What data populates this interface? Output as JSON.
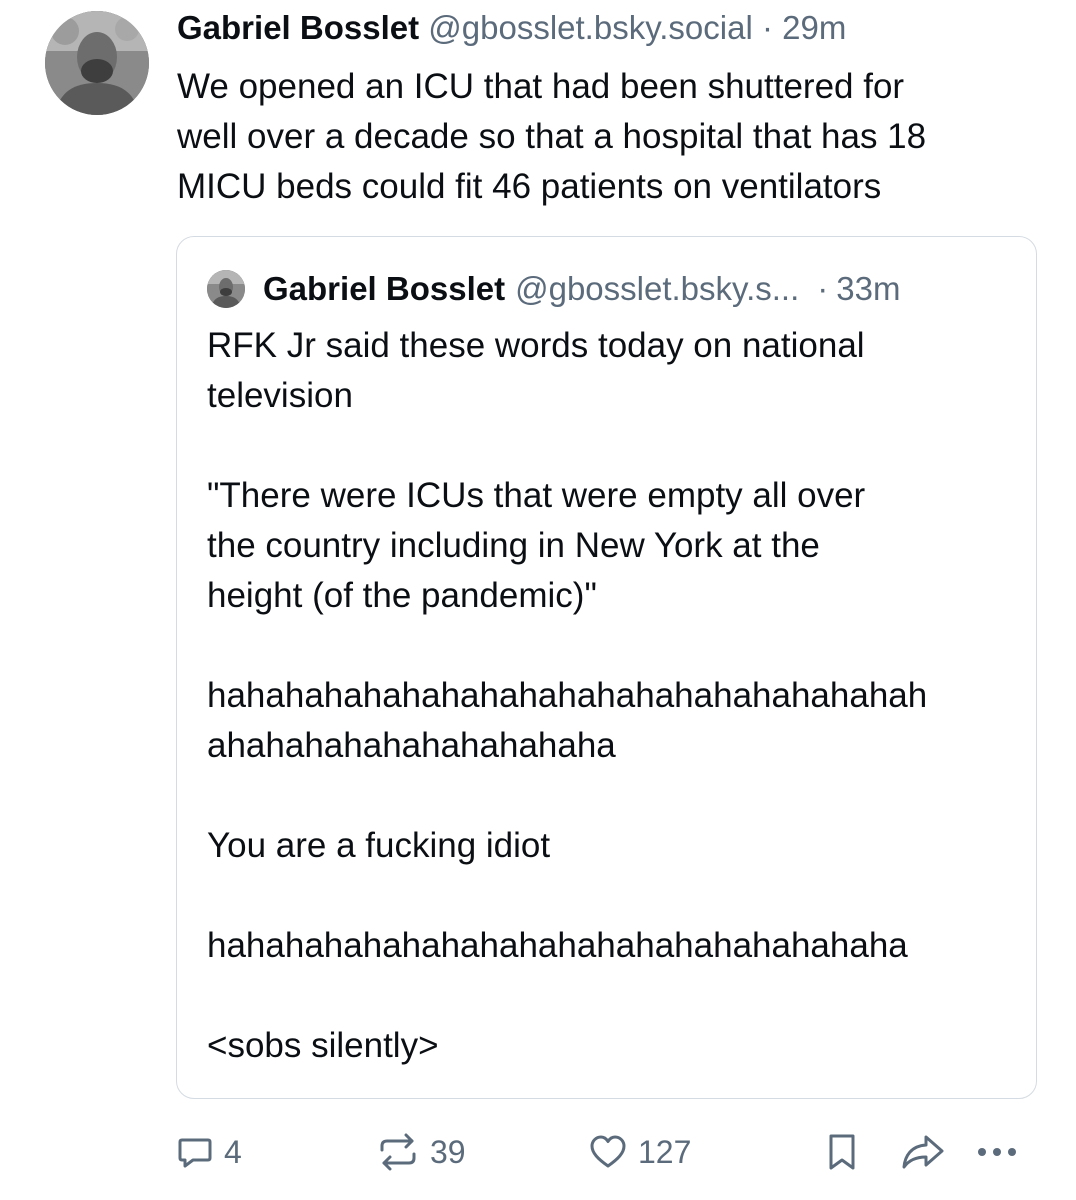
{
  "post": {
    "author_name": "Gabriel Bosslet",
    "handle": "@gbosslet.bsky.social",
    "separator": "·",
    "time": "29m",
    "text_lines": [
      "We opened an ICU that had been shuttered for",
      "well over a decade so that a hospital that has 18",
      "MICU beds could fit 46 patients on ventilators"
    ]
  },
  "quote": {
    "author_name": "Gabriel Bosslet",
    "handle": "@gbosslet.bsky.s...",
    "separator": "·",
    "time": "33m",
    "lines": [
      "RFK Jr said these words today on national",
      "television",
      "\"There were ICUs that were empty all over",
      "the country including in New York at the",
      "height (of the pandemic)\"",
      "hahahahahahahahahahahahahahahahahahah",
      "ahahahahahahahahahaha",
      "You are a fucking idiot",
      "hahahahahahahahahahahahahahahahahaha",
      "<sobs silently>"
    ]
  },
  "actions": {
    "reply_count": "4",
    "repost_count": "39",
    "like_count": "127",
    "icons": [
      "reply-icon",
      "repost-icon",
      "like-icon",
      "bookmark-icon",
      "share-icon",
      "more-icon"
    ]
  },
  "colors": {
    "text": "#0b0f14",
    "muted": "#5b6b7b",
    "border": "#d4dbe2"
  }
}
